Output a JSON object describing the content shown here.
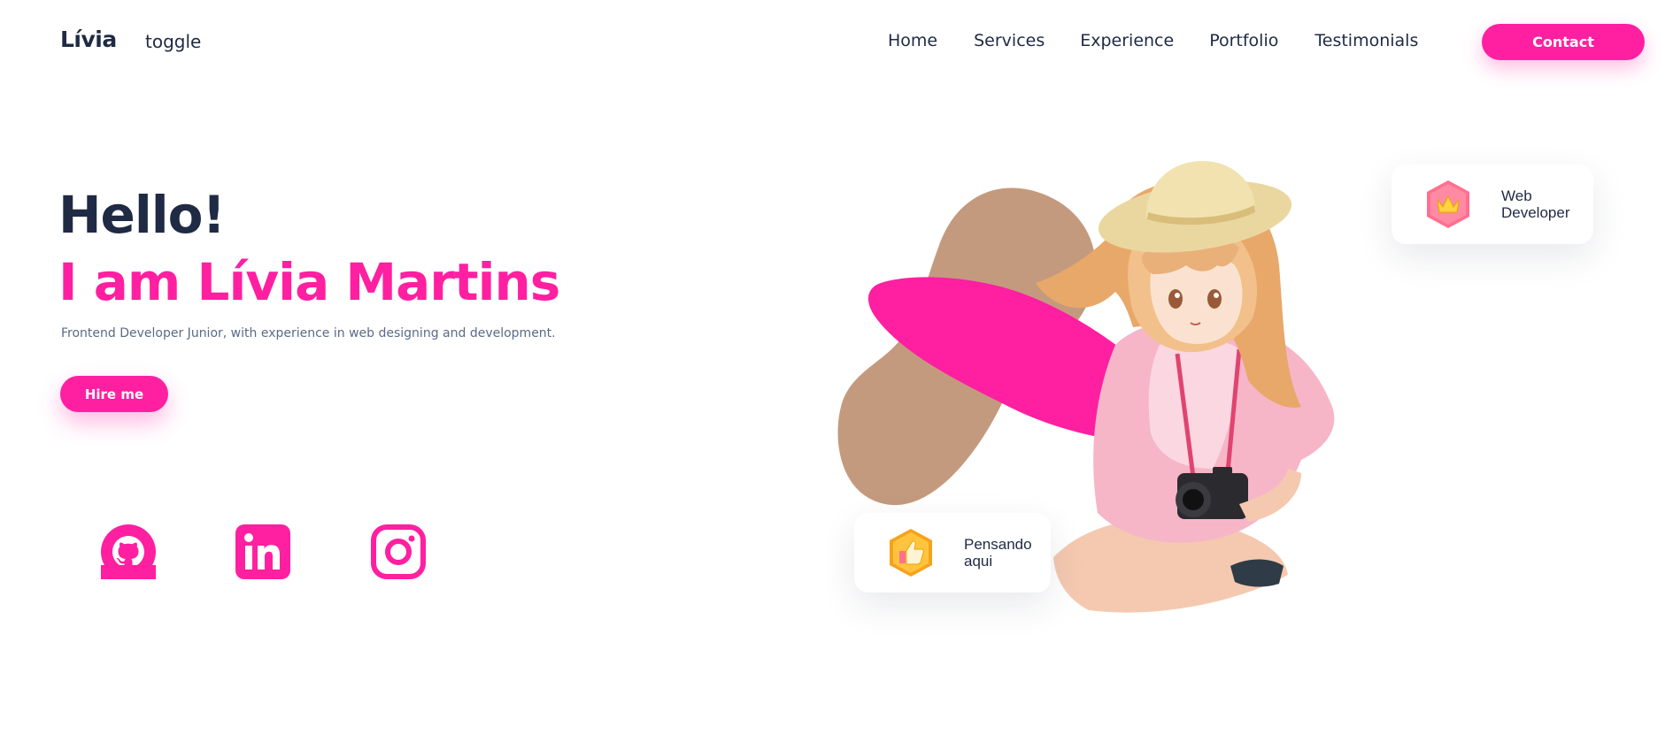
{
  "nav": {
    "logo": "Lívia",
    "toggle": "toggle",
    "links": [
      "Home",
      "Services",
      "Experience",
      "Portfolio",
      "Testimonials"
    ],
    "contact_label": "Contact"
  },
  "hero": {
    "greeting": "Hello!",
    "name": "I am Lívia Martins",
    "description": "Frontend Developer Junior, with experience in web designing and development.",
    "hire_label": "Hire me"
  },
  "social": [
    {
      "icon": "github-icon"
    },
    {
      "icon": "linkedin-icon"
    },
    {
      "icon": "instagram-icon"
    }
  ],
  "cards": {
    "web": {
      "line1": "Web",
      "line2": "Developer",
      "icon": "crown-icon"
    },
    "thinking": {
      "line1": "Pensando",
      "line2": "aqui",
      "icon": "thumbs-up-icon"
    }
  },
  "colors": {
    "accent": "#ff1fa1",
    "text": "#1f2a44",
    "muted": "#5c6a86",
    "blob_tan": "#c49a7e"
  }
}
